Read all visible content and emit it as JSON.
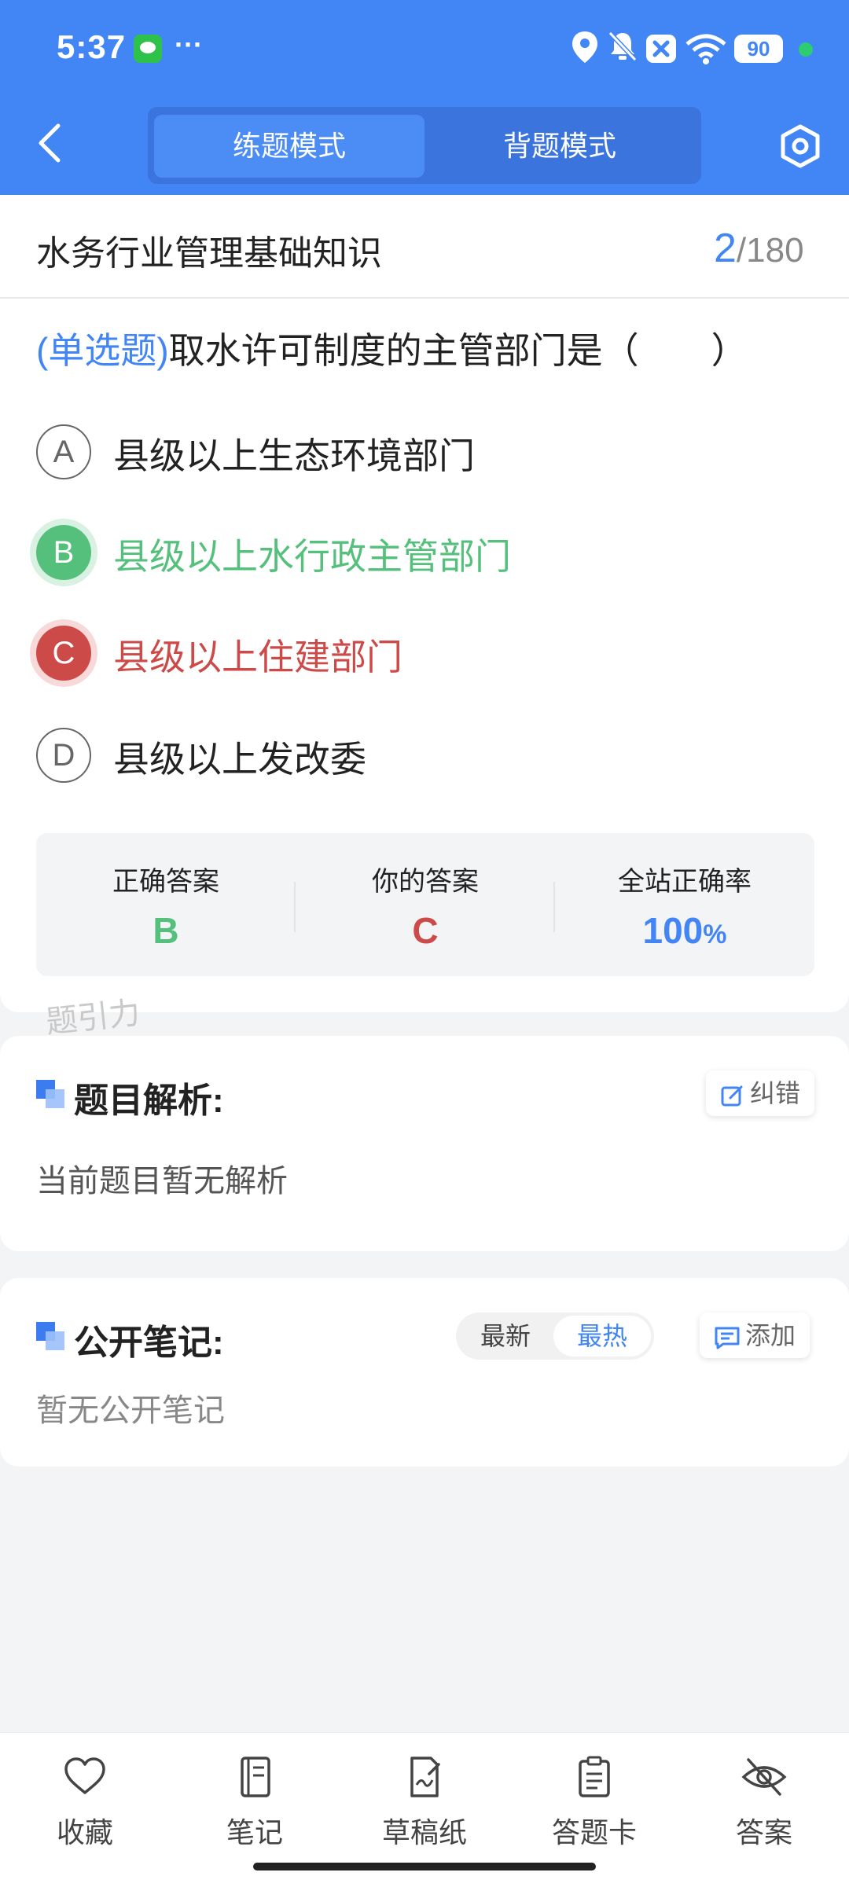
{
  "status_bar": {
    "time": "5:37",
    "more": "···",
    "battery": "90",
    "icons": [
      "wechat-icon",
      "location-icon",
      "mute-bell-icon",
      "close-box-icon",
      "wifi-icon",
      "battery-icon"
    ]
  },
  "header": {
    "mode_practice": "练题模式",
    "mode_recite": "背题模式"
  },
  "question_meta": {
    "subject": "水务行业管理基础知识",
    "current": "2",
    "separator": "/",
    "total": "180"
  },
  "question": {
    "type": "(单选题)",
    "text": "取水许可制度的主管部门是（　　）"
  },
  "options": [
    {
      "letter": "A",
      "text": "县级以上生态环境部门",
      "state": "normal"
    },
    {
      "letter": "B",
      "text": "县级以上水行政主管部门",
      "state": "correct"
    },
    {
      "letter": "C",
      "text": "县级以上住建部门",
      "state": "wrong"
    },
    {
      "letter": "D",
      "text": "县级以上发改委",
      "state": "normal"
    }
  ],
  "answer_stats": {
    "correct_label": "正确答案",
    "correct_value": "B",
    "yours_label": "你的答案",
    "yours_value": "C",
    "rate_label": "全站正确率",
    "rate_value": "100",
    "rate_unit": "%"
  },
  "watermark": "题引力",
  "analysis": {
    "title": "题目解析:",
    "correct_button": "纠错",
    "body": "当前题目暂无解析"
  },
  "notes": {
    "title": "公开笔记:",
    "sort_latest": "最新",
    "sort_hot": "最热",
    "add_button": "添加",
    "body": "暂无公开笔记"
  },
  "bottom_nav": {
    "favorite": "收藏",
    "notes": "笔记",
    "scratch": "草稿纸",
    "answer_card": "答题卡",
    "answer": "答案"
  },
  "colors": {
    "primary": "#4285f4",
    "correct": "#55c07b",
    "wrong": "#cc4a48"
  }
}
